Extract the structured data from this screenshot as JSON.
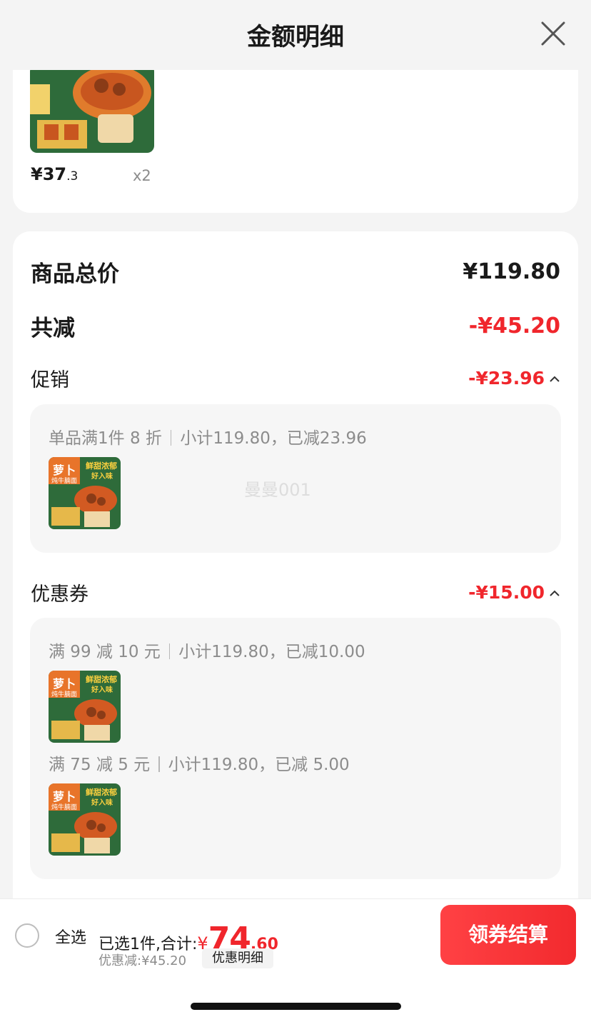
{
  "header": {
    "title": "金额明细"
  },
  "item": {
    "price_main": "¥37",
    "price_decimal": ".3",
    "quantity": "x2"
  },
  "summary": {
    "total_label": "商品总价",
    "total_value": "¥119.80",
    "reduce_label": "共减",
    "reduce_value": "-¥45.20"
  },
  "promotion": {
    "label": "促销",
    "value": "-¥23.96",
    "rules": [
      {
        "name": "单品满1件 8 折",
        "detail": "小计119.80，已减23.96"
      }
    ]
  },
  "watermark": "曼曼001",
  "coupon": {
    "label": "优惠券",
    "value": "-¥15.00",
    "rules": [
      {
        "name": "满 99 减 10 元",
        "detail": "小计119.80，已减10.00"
      },
      {
        "name": "满 75 减 5 元",
        "detail": "小计119.80，已减 5.00"
      }
    ]
  },
  "bottom": {
    "select_all": "全选",
    "selected_text": "已选1件,合计:",
    "yen": "¥",
    "total_int": "74",
    "total_dec": ".60",
    "discount": "优惠减:¥45.20",
    "detail_button": "优惠明细",
    "checkout_button": "领券结算"
  },
  "product_thumb_text": {
    "brand": "萝卜",
    "sub": "炖牛腩面",
    "slogan1": "鲜甜浓郁",
    "slogan2": "好入味"
  },
  "colors": {
    "accent_red": "#f0262c",
    "package_green": "#2e6b3a"
  }
}
